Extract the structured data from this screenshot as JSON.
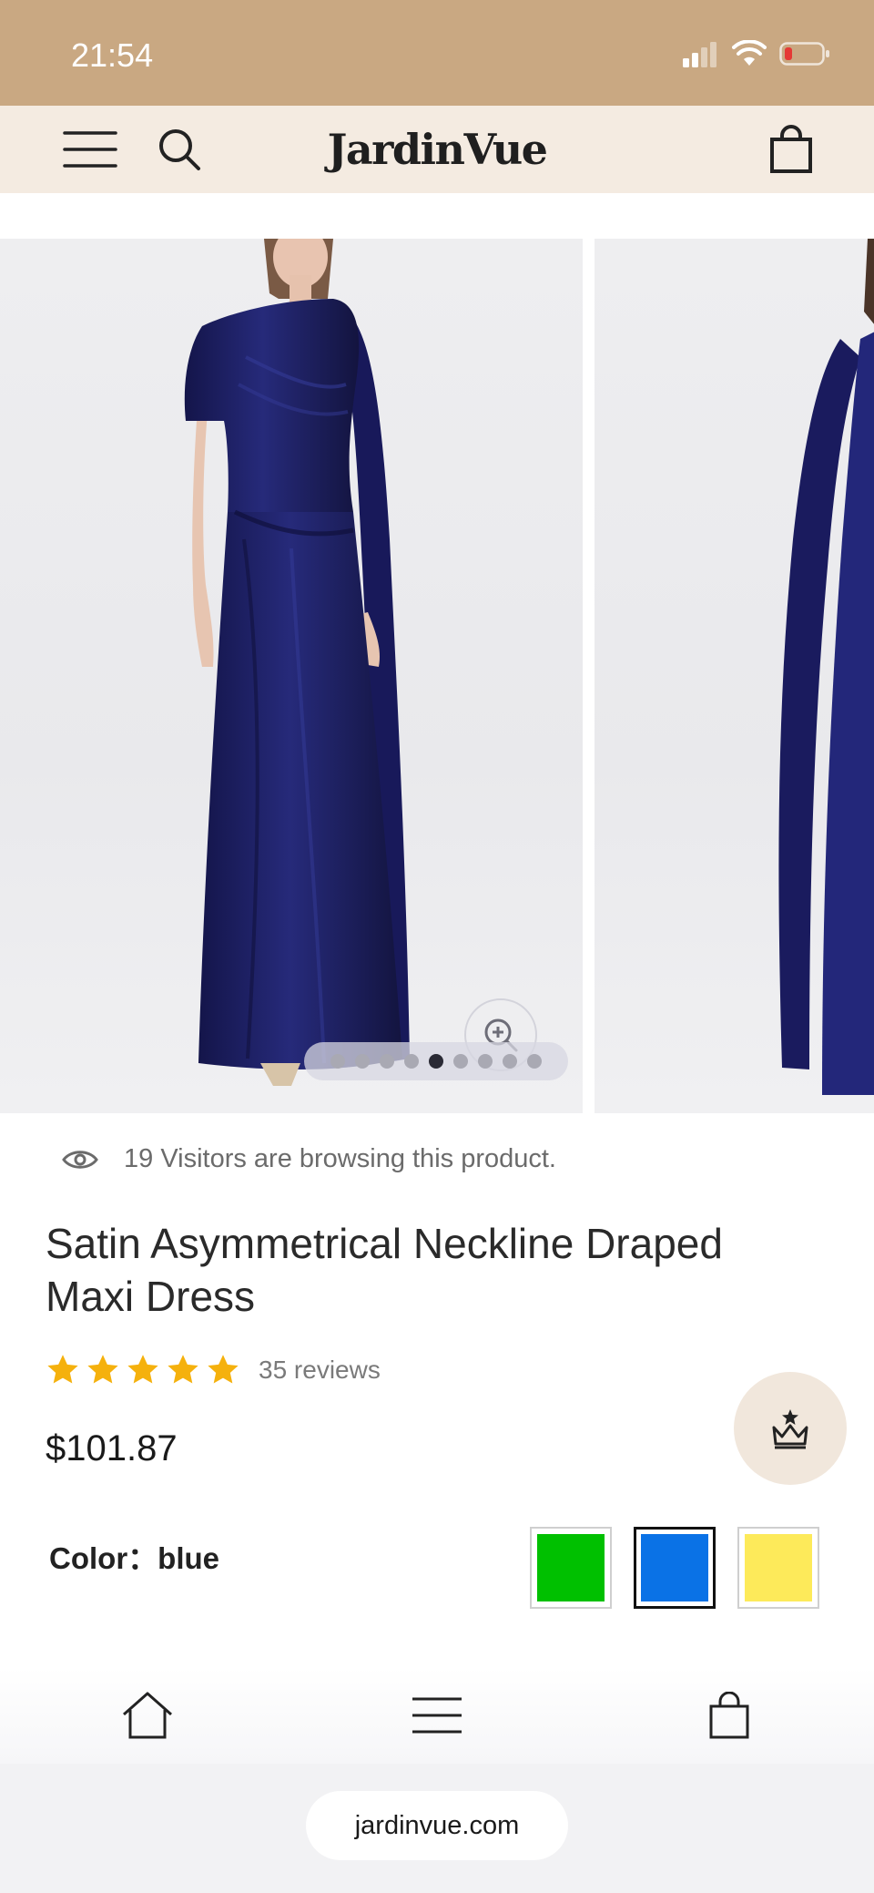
{
  "status_bar": {
    "time": "21:54",
    "icons": [
      "signal-icon",
      "wifi-icon",
      "battery-icon"
    ]
  },
  "header": {
    "menu_icon": "hamburger-icon",
    "search_icon": "search-icon",
    "logo": "JardinVue",
    "cart_icon": "shopping-bag-icon",
    "background": "#f4ebe1"
  },
  "gallery": {
    "slide_count": 9,
    "active_slide": 4,
    "zoom_icon": "zoom-in-icon",
    "product_color": "#1d1e5c"
  },
  "product": {
    "visitors_text": "19 Visitors are browsing this product.",
    "title": "Satin Asymmetrical Neckline Draped Maxi Dress",
    "rating": 5,
    "reviews": "35 reviews",
    "price": "$101.87",
    "color_label": "Color",
    "color_sep": "：",
    "color_value": "blue",
    "swatches": [
      {
        "name": "green",
        "color": "#00c000",
        "selected": false
      },
      {
        "name": "blue",
        "color": "#0a72e6",
        "selected": true
      },
      {
        "name": "yellow",
        "color": "#fdea5a",
        "selected": false
      }
    ]
  },
  "floating": {
    "crown_icon": "crown-icon"
  },
  "bottom_nav": {
    "items": [
      "home-icon",
      "menu-icon",
      "bag-icon"
    ]
  },
  "browser": {
    "url": "jardinvue.com"
  },
  "colors": {
    "status_bar": "#c9a882",
    "star": "#f5b10d",
    "accent_bg": "#f1e7dc"
  }
}
